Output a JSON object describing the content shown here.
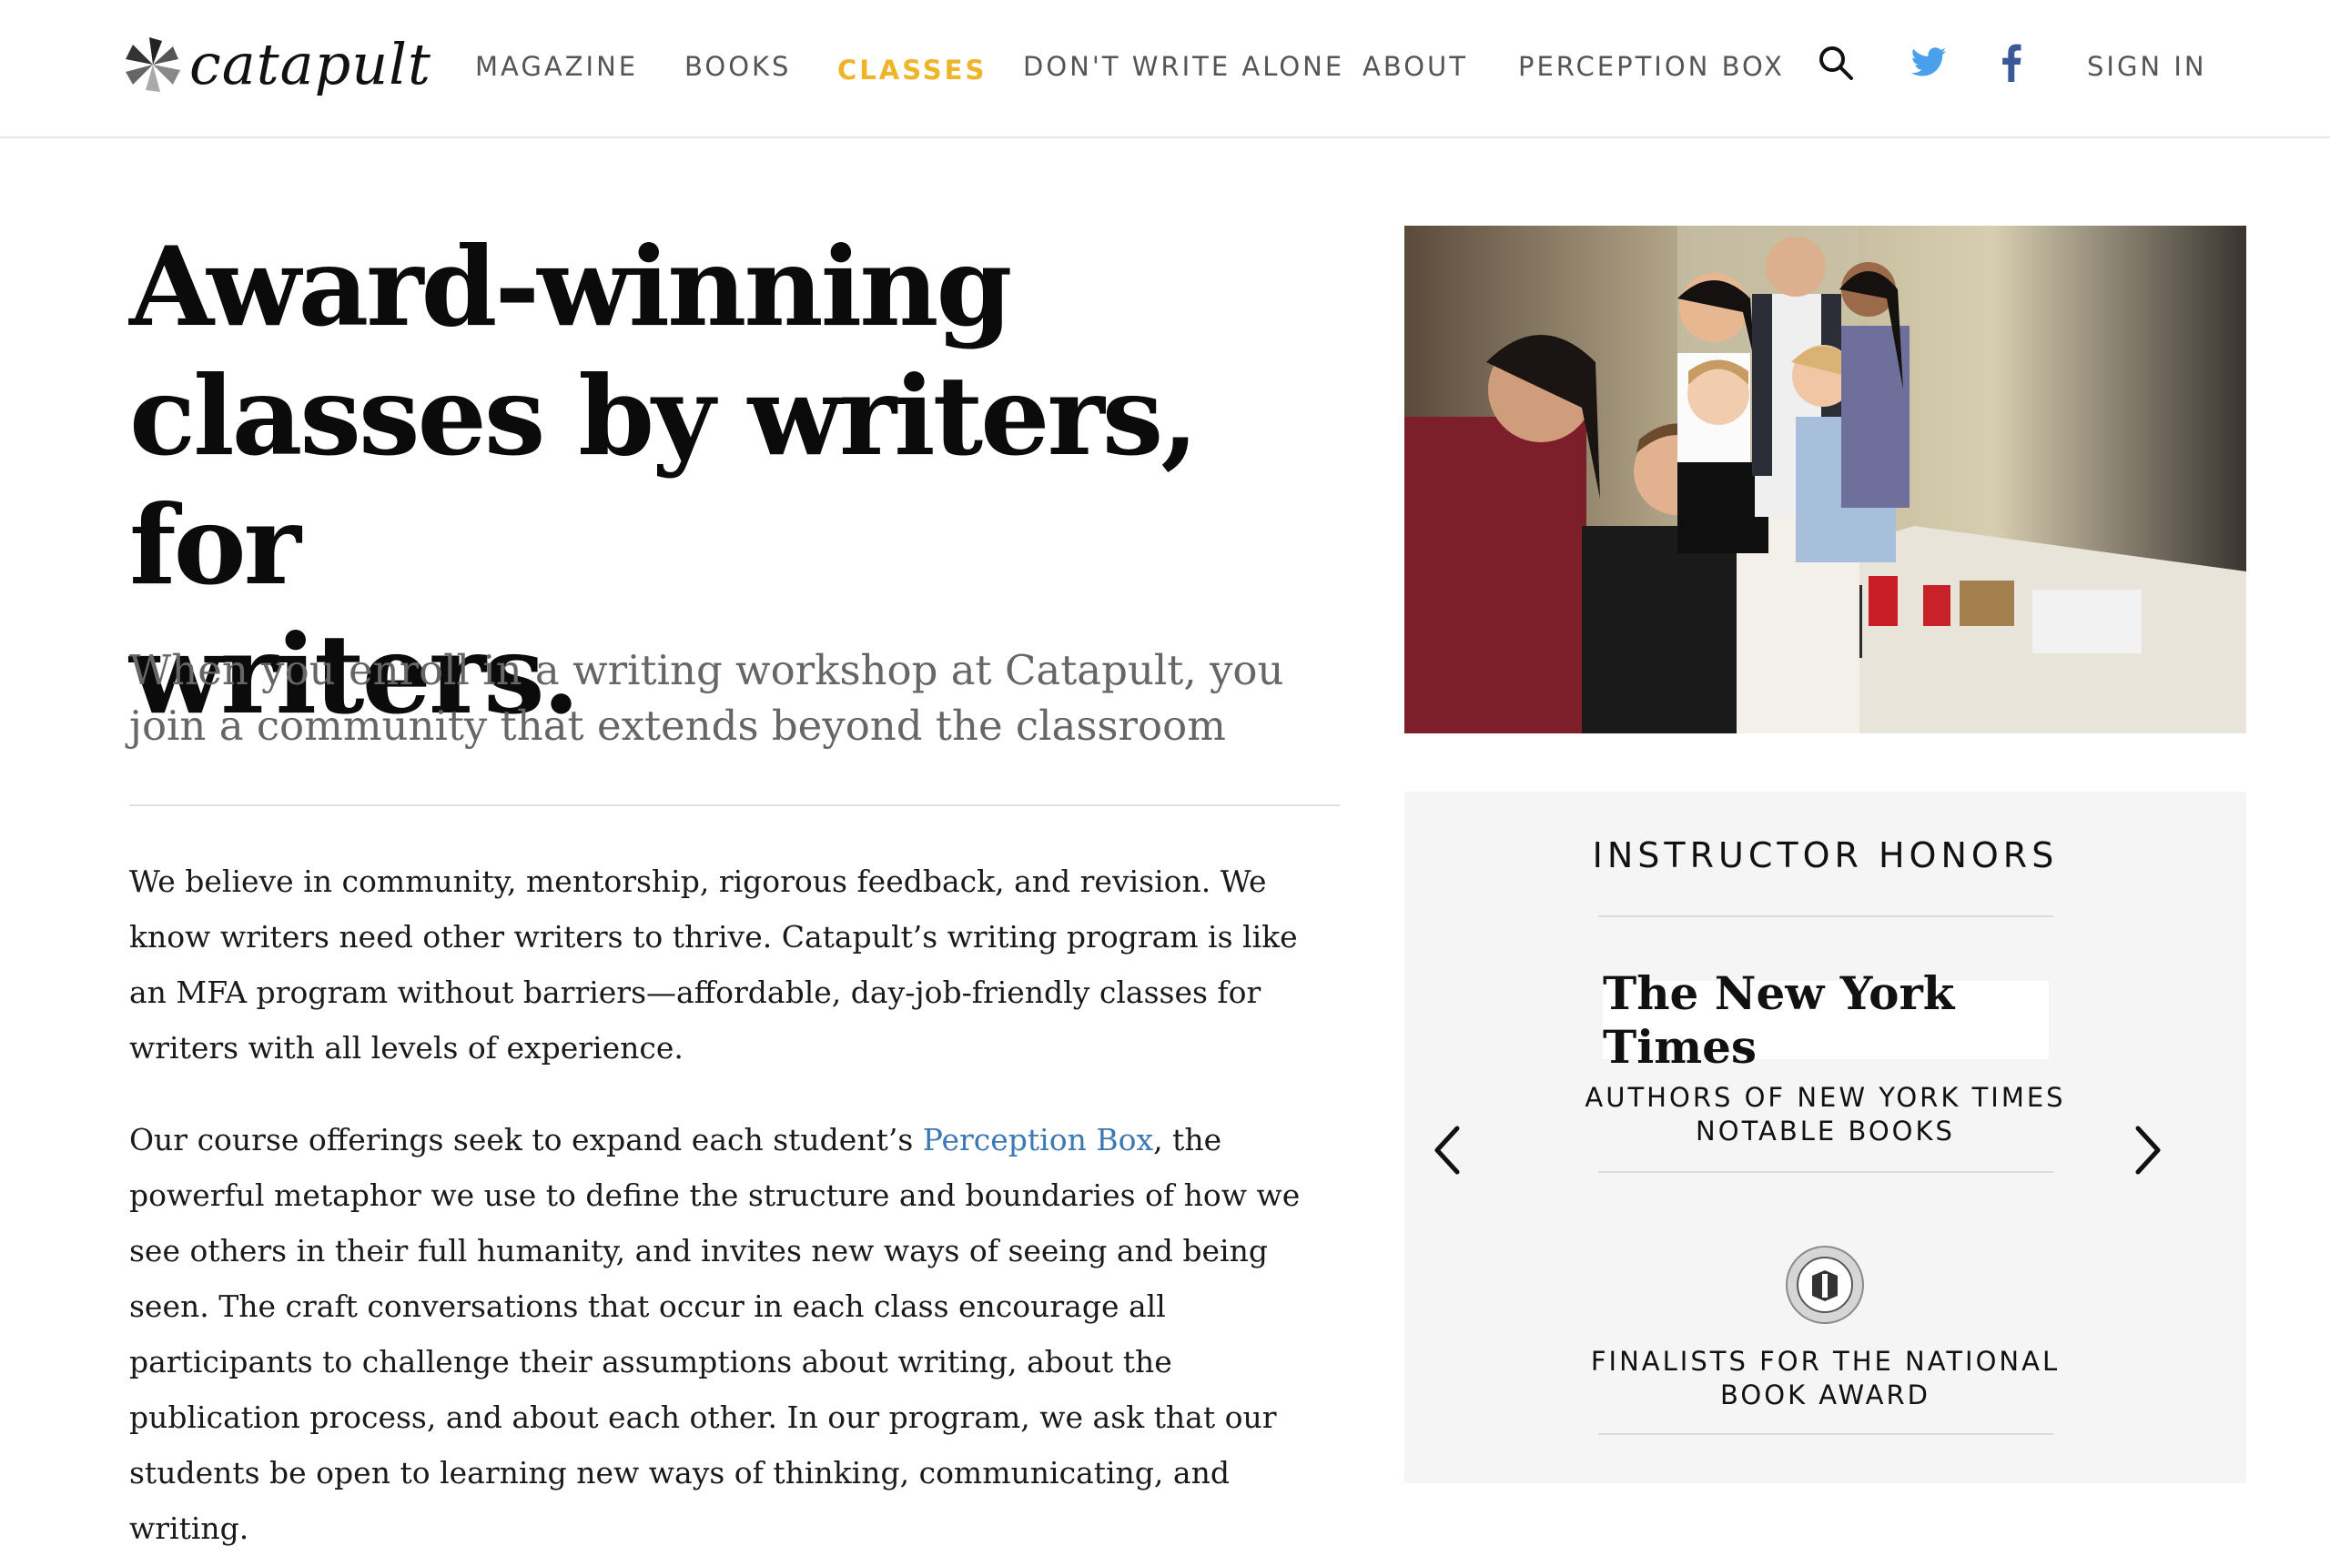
{
  "brand": {
    "name": "catapult"
  },
  "nav": {
    "items": [
      {
        "label": "MAGAZINE"
      },
      {
        "label": "BOOKS"
      },
      {
        "label": "CLASSES"
      },
      {
        "label": "DON'T WRITE ALONE"
      },
      {
        "label": "ABOUT"
      },
      {
        "label": "PERCEPTION BOX"
      }
    ],
    "sign_in": "SIGN IN",
    "icons": [
      "search-icon",
      "twitter-icon",
      "facebook-icon"
    ],
    "active_color": "#f0b429"
  },
  "hero": {
    "title_lines": [
      "Award-winning",
      "classes by writers, for",
      "writers."
    ],
    "subtitle": "When you enroll in a writing workshop at Catapult, you join a community that extends beyond the classroom"
  },
  "body": {
    "p1": "We believe in community, mentorship, rigorous feedback, and revision. We know writers need other writers to thrive. Catapult’s writing program is like an MFA program without barriers—affordable, day-job-friendly classes for writers with all levels of experience.",
    "p2_before": "Our course offerings seek to expand each student’s ",
    "p2_link": "Perception Box",
    "p2_after": ", the powerful metaphor we use to define the structure and boundaries of how we see others in their full humanity, and invites new ways of seeing and being seen. The craft conversations that occur in each class encourage all participants to challenge their assumptions about writing, about the publication process, and about each other. In our program, we ask that our students be open to learning new ways of thinking, communicating, and writing."
  },
  "honors": {
    "title": "INSTRUCTOR HONORS",
    "items": [
      {
        "logo_text": "The New York Times",
        "label_line1": "AUTHORS OF NEW YORK TIMES",
        "label_line2": "NOTABLE BOOKS"
      },
      {
        "logo": "national-book-award-seal",
        "label_line1": "FINALISTS FOR THE NATIONAL",
        "label_line2": "BOOK AWARD"
      }
    ]
  },
  "colors": {
    "link": "#3b78b5",
    "twitter": "#4aa1eb",
    "facebook": "#3b5998"
  }
}
